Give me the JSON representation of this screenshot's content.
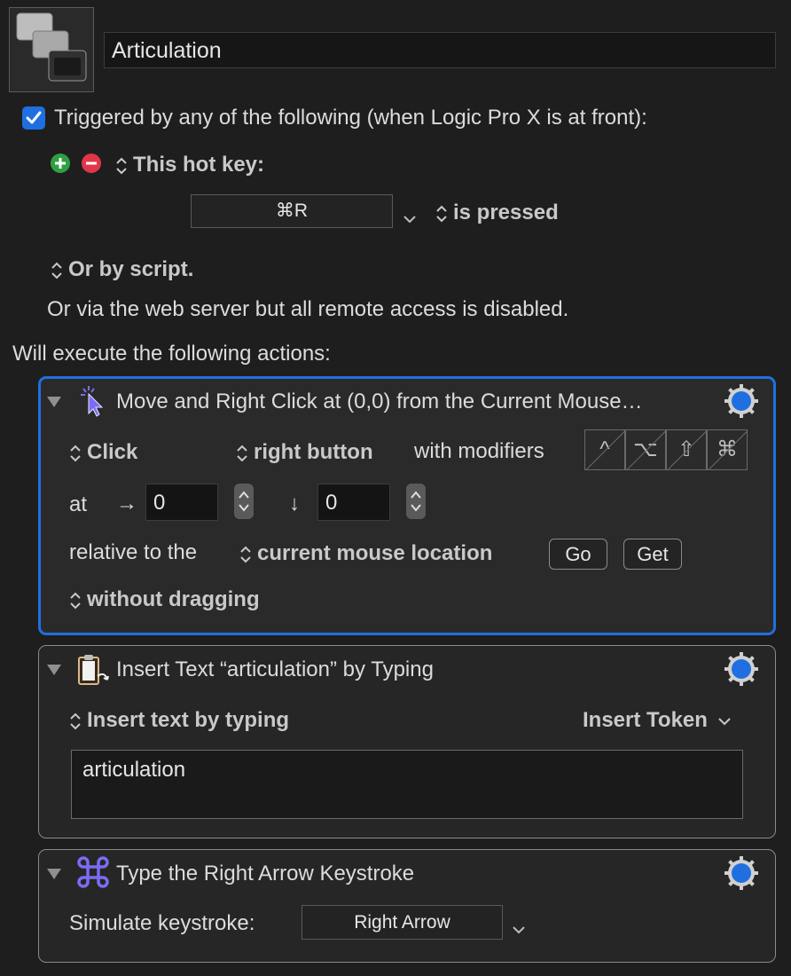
{
  "macro": {
    "name": "Articulation"
  },
  "trigger": {
    "checked": true,
    "heading": "Triggered by any of the following (when Logic Pro X is at front):",
    "hotkey_label": "This hot key:",
    "hotkey_value": "⌘R",
    "hotkey_condition": "is pressed",
    "script_label": "Or by script.",
    "webserver_note": "Or via the web server but all remote access is disabled."
  },
  "actions_heading": "Will execute the following actions:",
  "action1": {
    "title": "Move and Right Click at (0,0) from the Current Mouse…",
    "click_mode": "Click",
    "button": "right button",
    "modifiers_label": "with modifiers",
    "modifiers": [
      "^",
      "⌥",
      "⇧",
      "⌘"
    ],
    "at_label": "at",
    "x_arrow": "→",
    "x_value": "0",
    "y_arrow": "↓",
    "y_value": "0",
    "relative_label": "relative to the",
    "relative_to": "current mouse location",
    "go_label": "Go",
    "get_label": "Get",
    "drag_mode": "without dragging"
  },
  "action2": {
    "title": "Insert Text “articulation” by Typing",
    "mode": "Insert text by typing",
    "token_label": "Insert Token",
    "text": "articulation"
  },
  "action3": {
    "title": "Type the Right Arrow Keystroke",
    "simulate_label": "Simulate keystroke:",
    "key": "Right Arrow"
  },
  "colors": {
    "accent": "#1f6fe0",
    "add": "#2ea043",
    "remove": "#e0364a",
    "gear": "#1f6fe0"
  }
}
